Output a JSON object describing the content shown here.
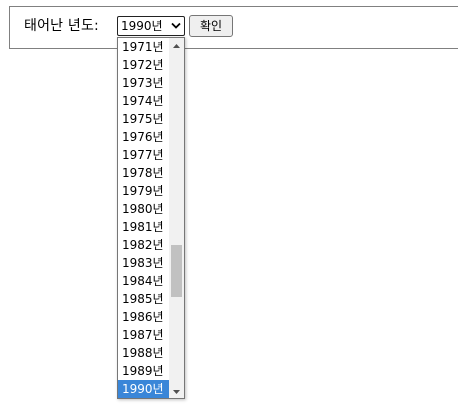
{
  "form": {
    "label": "태어난 년도:",
    "selected_value": "1990년",
    "confirm_label": "확인"
  },
  "dropdown": {
    "options": [
      "1971년",
      "1972년",
      "1973년",
      "1974년",
      "1975년",
      "1976년",
      "1977년",
      "1978년",
      "1979년",
      "1980년",
      "1981년",
      "1982년",
      "1983년",
      "1984년",
      "1985년",
      "1986년",
      "1987년",
      "1988년",
      "1989년",
      "1990년"
    ],
    "selected_index": 19
  },
  "colors": {
    "highlight": "#3a86d8",
    "scroll_thumb": "#c1c1c1",
    "scroll_track": "#f1f1f1"
  }
}
